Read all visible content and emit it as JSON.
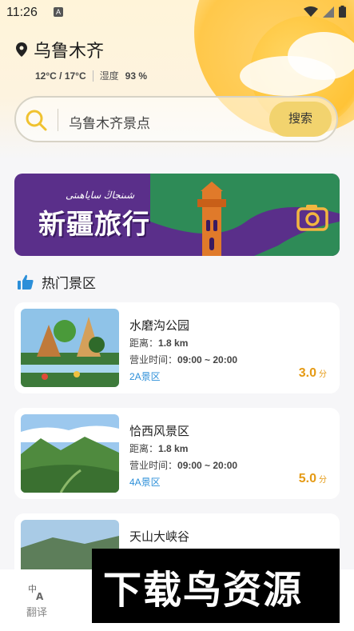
{
  "status_bar": {
    "time": "11:26",
    "notification_icon": "A"
  },
  "header": {
    "city": "乌鲁木齐",
    "temperature": "12°C / 17°C",
    "humidity_label": "湿度",
    "humidity_value": "93 %"
  },
  "search": {
    "placeholder": "乌鲁木齐景点",
    "button_label": "搜索"
  },
  "banner": {
    "title": "新疆旅行",
    "script_text": "شىنجاڭ ساياھىتى",
    "icon": "camera-icon"
  },
  "section": {
    "title": "热门景区",
    "icon": "thumbs-up-icon"
  },
  "spots": [
    {
      "name": "水磨沟公园",
      "distance_label": "距离：",
      "distance": "1.8 km",
      "hours_label": "营业时间：",
      "hours": "09:00 ~ 20:00",
      "grade": "2A景区",
      "score": "3.0",
      "score_unit": "分"
    },
    {
      "name": "恰西风景区",
      "distance_label": "距离：",
      "distance": "1.8 km",
      "hours_label": "营业时间：",
      "hours": "09:00 ~ 20:00",
      "grade": "4A景区",
      "score": "5.0",
      "score_unit": "分"
    },
    {
      "name": "天山大峡谷"
    }
  ],
  "bottom_nav": {
    "items": [
      {
        "label": "翻译",
        "icon": "translate-icon"
      }
    ]
  },
  "watermark": {
    "text": "下载鸟资源"
  },
  "colors": {
    "accent": "#f2d36e",
    "score": "#e59a14",
    "grade": "#2c8fd9",
    "banner": "#5a2f8a"
  }
}
